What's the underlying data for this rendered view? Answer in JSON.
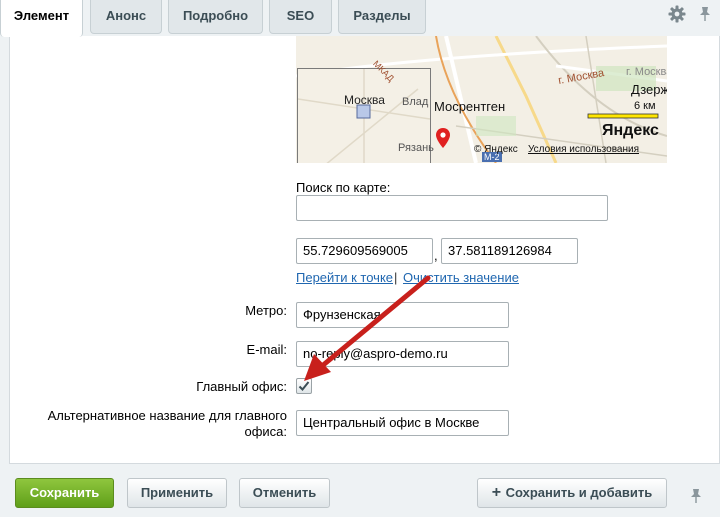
{
  "tabs": [
    {
      "label": "Элемент",
      "active": true
    },
    {
      "label": "Анонс",
      "active": false
    },
    {
      "label": "Подробно",
      "active": false
    },
    {
      "label": "SEO",
      "active": false
    },
    {
      "label": "Разделы",
      "active": false
    }
  ],
  "map": {
    "labels": {
      "moscow": "Москва",
      "mosrentgen": "Мосрентген",
      "dzerzh": "Дзерж",
      "vlad": "Влад",
      "ryazan": "Рязань",
      "road_a": "г. Москва",
      "road_b": "г. Москва",
      "mkad": "МКАД",
      "m2": "М-2"
    },
    "scale_text": "6 км",
    "logo_text": "Яндекс",
    "copyright": "© Яндекс",
    "terms_link": "Условия использования"
  },
  "search": {
    "label": "Поиск по карте:",
    "value": ""
  },
  "coords": {
    "lat": "55.729609569005",
    "separator": ",",
    "lon": "37.581189126984",
    "go_link": "Перейти к точке",
    "divider": "|",
    "clear_link": "Очистить значение"
  },
  "fields": {
    "metro_label": "Метро:",
    "metro_value": "Фрунзенская",
    "email_label": "E-mail:",
    "email_value": "no-reply@aspro-demo.ru",
    "main_office_label": "Главный офис:",
    "main_office_checked": true,
    "alt_name_label_line1": "Альтернативное название для главного",
    "alt_name_label_line2": "офиса:",
    "alt_name_value": "Центральный офис в Москве"
  },
  "buttons": {
    "save": "Сохранить",
    "apply": "Применить",
    "cancel": "Отменить",
    "save_add": "Сохранить и добавить"
  },
  "colors": {
    "accent_green": "#6aaa22",
    "link_blue": "#2067b0",
    "annotation_red": "#c8201c"
  }
}
